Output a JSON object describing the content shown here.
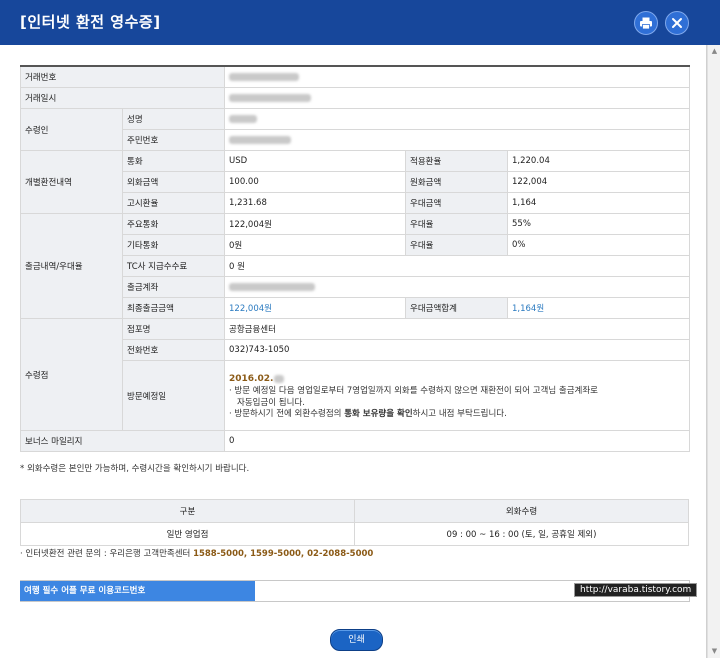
{
  "window": {
    "title": "[인터넷 환전 영수증]"
  },
  "header_icons": {
    "print": "print-icon",
    "close": "close-icon"
  },
  "colors": {
    "header": "#17479b",
    "accent": "#3d86e2",
    "link": "#2a7ac0",
    "emphasis": "#8b5a16"
  },
  "receipt": {
    "txn_no_label": "거래번호",
    "txn_date_label": "거래일시",
    "recipient_label": "수령인",
    "name_label": "성명",
    "resident_no_label": "주민번호",
    "exchange_label": "개별환전내역",
    "currency_label": "통화",
    "currency_value": "USD",
    "applied_rate_label": "적용환율",
    "applied_rate_value": "1,220.04",
    "fx_amount_label": "외화금액",
    "fx_amount_value": "100.00",
    "krw_amount_label": "원화금액",
    "krw_amount_value": "122,004",
    "notice_rate_label": "고시환율",
    "notice_rate_value": "1,231.68",
    "pref_amount_label": "우대금액",
    "pref_amount_value": "1,164",
    "withdraw_label": "출금내역/우대율",
    "main_curr_label": "주요통화",
    "main_curr_value": "122,004원",
    "pref_rate_label": "우대율",
    "pref_rate_value": "55%",
    "other_curr_label": "기타통화",
    "other_curr_value": "0원",
    "pref_rate2_label": "우대율",
    "pref_rate2_value": "0%",
    "tc_fee_label": "TC사 지급수수료",
    "tc_fee_value": "0 원",
    "account_label": "출금계좌",
    "final_label": "최종출금금액",
    "final_value": "122,004원",
    "pref_total_label": "우대금액합계",
    "pref_total_value": "1,164원",
    "pickup_label": "수령점",
    "branch_label": "점포명",
    "branch_value": "공항금융센터",
    "phone_label": "전화번호",
    "phone_value": "032)743-1050",
    "visit_label": "방문예정일",
    "visit_value": "2016.02.",
    "visit_note1": "방문 예정일 다음 영업일로부터 7영업일까지 외화를 수령하지 않으면 재환전이 되어 고객님 출금계좌로",
    "visit_note1b": "자동입금이 됩니다.",
    "visit_note2a": "방문하시기 전에 외환수령점의 ",
    "visit_note2b": "통화 보유량을 확인",
    "visit_note2c": "하시고 내점 부탁드립니다.",
    "bonus_label": "보너스 마일리지",
    "bonus_value": "0"
  },
  "note_pickup": "* 외화수령은 본인만 가능하며, 수령시간을 확인하시기 바랍니다.",
  "hours": {
    "col1": "구분",
    "col2": "외화수령",
    "row_type": "일반 영업점",
    "row_time": "09 : 00 ~ 16 : 00 (토, 일, 공휴일 제외)"
  },
  "inquiry": {
    "prefix": "· 인터넷환전 관련 문의 : 우리은행 고객만족센터 ",
    "phones": "1588-5000, 1599-5000, 02-2088-5000"
  },
  "code_bar": {
    "label": "여행 필수 어플 무료 이용코드번호",
    "value": ""
  },
  "watermark": "http://varaba.tistory.com",
  "print_button": "인쇄"
}
